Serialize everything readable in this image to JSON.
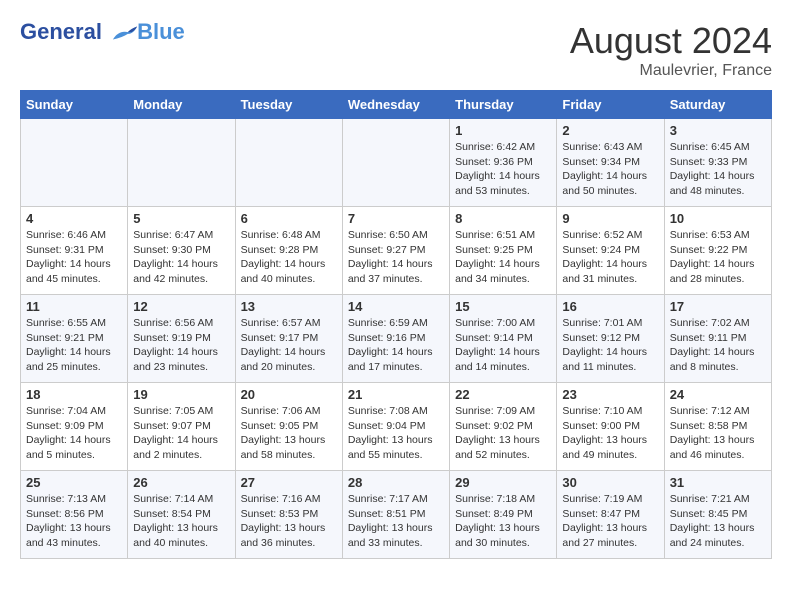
{
  "header": {
    "logo_line1": "General",
    "logo_line2": "Blue",
    "month": "August 2024",
    "location": "Maulevrier, France"
  },
  "days_of_week": [
    "Sunday",
    "Monday",
    "Tuesday",
    "Wednesday",
    "Thursday",
    "Friday",
    "Saturday"
  ],
  "weeks": [
    [
      {
        "day": "",
        "info": ""
      },
      {
        "day": "",
        "info": ""
      },
      {
        "day": "",
        "info": ""
      },
      {
        "day": "",
        "info": ""
      },
      {
        "day": "1",
        "info": "Sunrise: 6:42 AM\nSunset: 9:36 PM\nDaylight: 14 hours\nand 53 minutes."
      },
      {
        "day": "2",
        "info": "Sunrise: 6:43 AM\nSunset: 9:34 PM\nDaylight: 14 hours\nand 50 minutes."
      },
      {
        "day": "3",
        "info": "Sunrise: 6:45 AM\nSunset: 9:33 PM\nDaylight: 14 hours\nand 48 minutes."
      }
    ],
    [
      {
        "day": "4",
        "info": "Sunrise: 6:46 AM\nSunset: 9:31 PM\nDaylight: 14 hours\nand 45 minutes."
      },
      {
        "day": "5",
        "info": "Sunrise: 6:47 AM\nSunset: 9:30 PM\nDaylight: 14 hours\nand 42 minutes."
      },
      {
        "day": "6",
        "info": "Sunrise: 6:48 AM\nSunset: 9:28 PM\nDaylight: 14 hours\nand 40 minutes."
      },
      {
        "day": "7",
        "info": "Sunrise: 6:50 AM\nSunset: 9:27 PM\nDaylight: 14 hours\nand 37 minutes."
      },
      {
        "day": "8",
        "info": "Sunrise: 6:51 AM\nSunset: 9:25 PM\nDaylight: 14 hours\nand 34 minutes."
      },
      {
        "day": "9",
        "info": "Sunrise: 6:52 AM\nSunset: 9:24 PM\nDaylight: 14 hours\nand 31 minutes."
      },
      {
        "day": "10",
        "info": "Sunrise: 6:53 AM\nSunset: 9:22 PM\nDaylight: 14 hours\nand 28 minutes."
      }
    ],
    [
      {
        "day": "11",
        "info": "Sunrise: 6:55 AM\nSunset: 9:21 PM\nDaylight: 14 hours\nand 25 minutes."
      },
      {
        "day": "12",
        "info": "Sunrise: 6:56 AM\nSunset: 9:19 PM\nDaylight: 14 hours\nand 23 minutes."
      },
      {
        "day": "13",
        "info": "Sunrise: 6:57 AM\nSunset: 9:17 PM\nDaylight: 14 hours\nand 20 minutes."
      },
      {
        "day": "14",
        "info": "Sunrise: 6:59 AM\nSunset: 9:16 PM\nDaylight: 14 hours\nand 17 minutes."
      },
      {
        "day": "15",
        "info": "Sunrise: 7:00 AM\nSunset: 9:14 PM\nDaylight: 14 hours\nand 14 minutes."
      },
      {
        "day": "16",
        "info": "Sunrise: 7:01 AM\nSunset: 9:12 PM\nDaylight: 14 hours\nand 11 minutes."
      },
      {
        "day": "17",
        "info": "Sunrise: 7:02 AM\nSunset: 9:11 PM\nDaylight: 14 hours\nand 8 minutes."
      }
    ],
    [
      {
        "day": "18",
        "info": "Sunrise: 7:04 AM\nSunset: 9:09 PM\nDaylight: 14 hours\nand 5 minutes."
      },
      {
        "day": "19",
        "info": "Sunrise: 7:05 AM\nSunset: 9:07 PM\nDaylight: 14 hours\nand 2 minutes."
      },
      {
        "day": "20",
        "info": "Sunrise: 7:06 AM\nSunset: 9:05 PM\nDaylight: 13 hours\nand 58 minutes."
      },
      {
        "day": "21",
        "info": "Sunrise: 7:08 AM\nSunset: 9:04 PM\nDaylight: 13 hours\nand 55 minutes."
      },
      {
        "day": "22",
        "info": "Sunrise: 7:09 AM\nSunset: 9:02 PM\nDaylight: 13 hours\nand 52 minutes."
      },
      {
        "day": "23",
        "info": "Sunrise: 7:10 AM\nSunset: 9:00 PM\nDaylight: 13 hours\nand 49 minutes."
      },
      {
        "day": "24",
        "info": "Sunrise: 7:12 AM\nSunset: 8:58 PM\nDaylight: 13 hours\nand 46 minutes."
      }
    ],
    [
      {
        "day": "25",
        "info": "Sunrise: 7:13 AM\nSunset: 8:56 PM\nDaylight: 13 hours\nand 43 minutes."
      },
      {
        "day": "26",
        "info": "Sunrise: 7:14 AM\nSunset: 8:54 PM\nDaylight: 13 hours\nand 40 minutes."
      },
      {
        "day": "27",
        "info": "Sunrise: 7:16 AM\nSunset: 8:53 PM\nDaylight: 13 hours\nand 36 minutes."
      },
      {
        "day": "28",
        "info": "Sunrise: 7:17 AM\nSunset: 8:51 PM\nDaylight: 13 hours\nand 33 minutes."
      },
      {
        "day": "29",
        "info": "Sunrise: 7:18 AM\nSunset: 8:49 PM\nDaylight: 13 hours\nand 30 minutes."
      },
      {
        "day": "30",
        "info": "Sunrise: 7:19 AM\nSunset: 8:47 PM\nDaylight: 13 hours\nand 27 minutes."
      },
      {
        "day": "31",
        "info": "Sunrise: 7:21 AM\nSunset: 8:45 PM\nDaylight: 13 hours\nand 24 minutes."
      }
    ]
  ]
}
